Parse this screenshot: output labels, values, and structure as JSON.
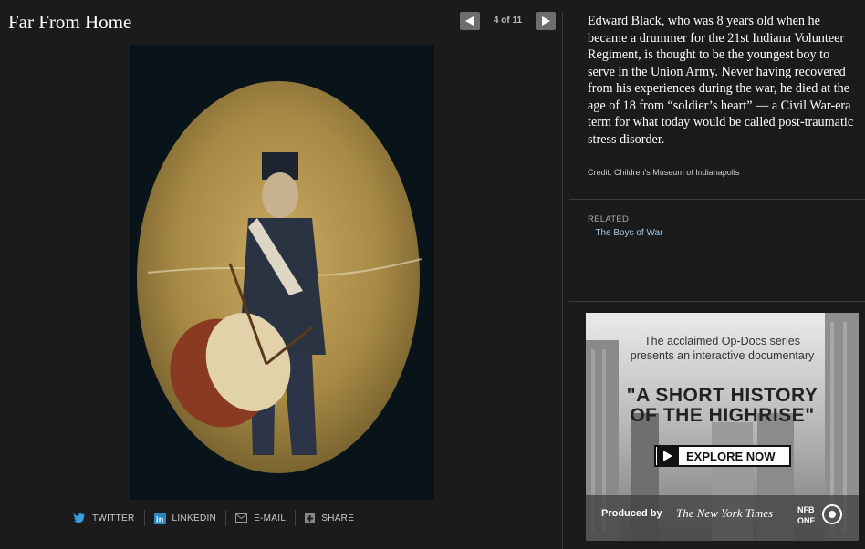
{
  "header": {
    "title": "Far From Home",
    "counter": "4 of 11"
  },
  "share": {
    "twitter": "TWITTER",
    "linkedin": "LINKEDIN",
    "email": "E-MAIL",
    "share": "SHARE"
  },
  "caption": {
    "text": "Edward Black, who was 8 years old when he became a drummer for the 21st Indiana Volunteer Regiment, is thought to be the youngest boy to serve in the Union Army. Never having recovered from his experiences during the war, he died at the age of 18 from “soldier’s heart” — a Civil War-era term for what today would be called post-traumatic stress disorder.",
    "credit": "Credit: Children's Museum of Indianapolis"
  },
  "related": {
    "label": "RELATED",
    "link": "The Boys of War"
  },
  "ad": {
    "line1": "The acclaimed Op-Docs series",
    "line2": "presents an interactive documentary",
    "headline1": "\"A SHORT HISTORY",
    "headline2": "OF THE HIGHRISE\"",
    "cta": "EXPLORE NOW",
    "produced_by": "Produced by",
    "nyt": "The New York Times",
    "nfb": "NFB ONF"
  },
  "colors": {
    "background": "#1b1b1b",
    "link": "#9fc7e6",
    "twitter": "#3a9fe0",
    "linkedin": "#2a87c2"
  }
}
